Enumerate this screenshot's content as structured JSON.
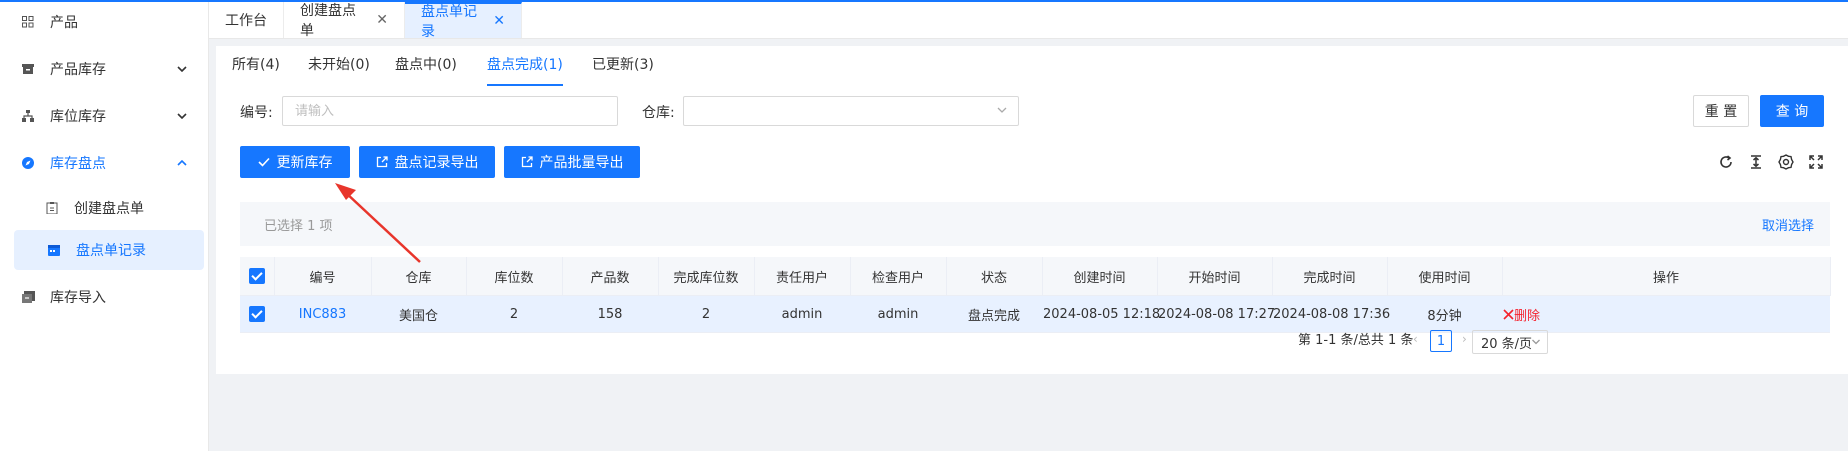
{
  "sidebar": {
    "items": [
      {
        "label": "产品",
        "icon": "grid-icon"
      },
      {
        "label": "产品库存",
        "icon": "box-icon"
      },
      {
        "label": "库位库存",
        "icon": "sitemap-icon"
      },
      {
        "label": "库存盘点",
        "icon": "compass-icon"
      },
      {
        "label": "创建盘点单",
        "icon": "clipboard-icon"
      },
      {
        "label": "盘点单记录",
        "icon": "calendar-icon"
      },
      {
        "label": "库存导入",
        "icon": "import-icon"
      }
    ]
  },
  "tabs": [
    {
      "label": "工作台"
    },
    {
      "label": "创建盘点单",
      "close": "✕"
    },
    {
      "label": "盘点单记录",
      "close": "✕"
    }
  ],
  "status_tabs": [
    "所有(4)",
    "未开始(0)",
    "盘点中(0)",
    "盘点完成(1)",
    "已更新(3)"
  ],
  "filters": {
    "code_label": "编号:",
    "code_placeholder": "请输入",
    "warehouse_label": "仓库:",
    "reset_label": "重 置",
    "search_label": "查 询"
  },
  "actions": {
    "update_stock": "更新库存",
    "export_records": "盘点记录导出",
    "export_products": "产品批量导出"
  },
  "selection": {
    "text": "已选择  1  项",
    "cancel": "取消选择"
  },
  "table": {
    "columns": [
      "编号",
      "仓库",
      "库位数",
      "产品数",
      "完成库位数",
      "责任用户",
      "检查用户",
      "状态",
      "创建时间",
      "开始时间",
      "完成时间",
      "使用时间",
      "操作"
    ],
    "rows": [
      {
        "code": "INC883",
        "warehouse": "美国仓",
        "locations": "2",
        "products": "158",
        "done_locations": "2",
        "owner": "admin",
        "checker": "admin",
        "status": "盘点完成",
        "created": "2024-08-05 12:18",
        "started": "2024-08-08 17:27",
        "finished": "2024-08-08 17:36",
        "duration": "8分钟",
        "delete_label": "删除"
      }
    ]
  },
  "pagination": {
    "total_text": "第 1-1 条/总共 1 条",
    "current_page": "1",
    "page_size": "20 条/页"
  },
  "colors": {
    "primary": "#1677ff",
    "danger": "#f5222d",
    "annotation": "#e8352b"
  }
}
